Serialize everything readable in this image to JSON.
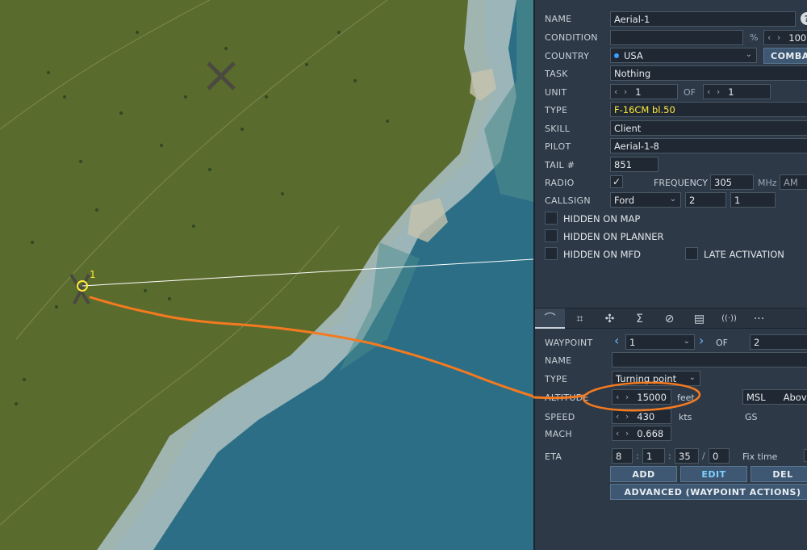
{
  "map": {
    "waypoint_label": "1",
    "colors": {
      "land": "#5a6b2e",
      "sea": "#2b6e86",
      "shallow": "#a7bcbf",
      "route": "#ffffff",
      "annotation": "#f47a20",
      "waypoint": "#ffe93a"
    }
  },
  "group": {
    "name_label": "NAME",
    "name_value": "Aerial-1",
    "help": "?",
    "condition_label": "CONDITION",
    "condition_value": "",
    "condition_unit": "%",
    "condition_num": "100",
    "country_label": "COUNTRY",
    "country_value": "USA",
    "combat_btn": "COMBAT",
    "task_label": "TASK",
    "task_value": "Nothing",
    "unit_label": "UNIT",
    "unit_value": "1",
    "unit_of": "OF",
    "unit_total": "1",
    "type_label": "TYPE",
    "type_value": "F-16CM bl.50",
    "skill_label": "SKILL",
    "skill_value": "Client",
    "pilot_label": "PILOT",
    "pilot_value": "Aerial-1-8",
    "tail_label": "TAIL #",
    "tail_value": "851",
    "radio_label": "RADIO",
    "radio_checked": true,
    "frequency_label": "FREQUENCY",
    "frequency_value": "305",
    "frequency_unit": "MHz",
    "modulation": "AM",
    "callsign_label": "CALLSIGN",
    "callsign_value": "Ford",
    "callsign_num1": "2",
    "callsign_num2": "1",
    "hidden_map": "HIDDEN ON MAP",
    "hidden_planner": "HIDDEN ON PLANNER",
    "hidden_mfd": "HIDDEN ON MFD",
    "late_activation": "LATE ACTIVATION"
  },
  "tabs": [
    {
      "icon": "route-icon",
      "glyph": "⌒"
    },
    {
      "icon": "target-icon",
      "glyph": "⌗"
    },
    {
      "icon": "payload-icon",
      "glyph": "✣"
    },
    {
      "icon": "summary-icon",
      "glyph": "Σ"
    },
    {
      "icon": "failures-icon",
      "glyph": "⊘"
    },
    {
      "icon": "fuel-icon",
      "glyph": "▤"
    },
    {
      "icon": "radio-icon",
      "glyph": "((·))"
    },
    {
      "icon": "more-icon",
      "glyph": "···"
    }
  ],
  "waypoint": {
    "waypoint_label": "WAYPOINT",
    "waypoint_value": "1",
    "of_label": "OF",
    "total": "2",
    "name_label": "NAME",
    "name_value": "",
    "type_label": "TYPE",
    "type_value": "Turning point",
    "altitude_label": "ALTITUDE",
    "altitude_value": "15000",
    "altitude_unit": "feet",
    "alt_ref": "MSL",
    "alt_ref2": "Above",
    "speed_label": "SPEED",
    "speed_value": "430",
    "speed_unit": "kts",
    "speed_ref": "GS",
    "mach_label": "MACH",
    "mach_value": "0.668",
    "eta_label": "ETA",
    "eta_d": "8",
    "eta_h": "1",
    "eta_m": "35",
    "eta_s": "0",
    "fix_time": "Fix time",
    "add_btn": "ADD",
    "edit_btn": "EDIT",
    "del_btn": "DEL",
    "advanced_btn": "ADVANCED (WAYPOINT ACTIONS)"
  }
}
